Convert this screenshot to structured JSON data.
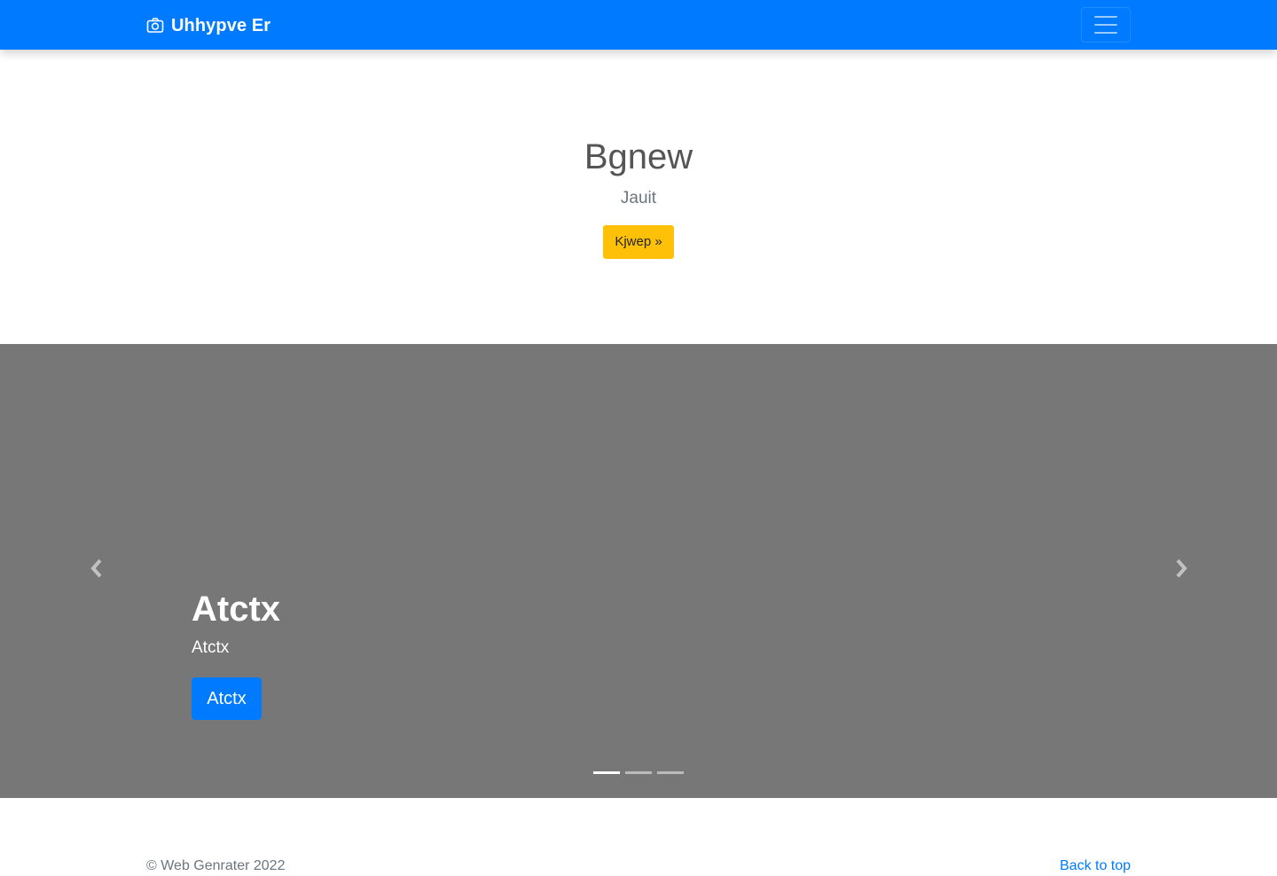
{
  "navbar": {
    "brand": "Uhhypve Er",
    "brand_icon": "camera-icon",
    "toggler_icon": "hamburger-menu-icon",
    "background_color": "#007bff"
  },
  "hero": {
    "title": "Bgnew",
    "subtitle": "Jauit",
    "button_label": "Kjwep »",
    "button_color": "#ffc107"
  },
  "carousel": {
    "background_color": "#777777",
    "prev_icon": "chevron-left-icon",
    "next_icon": "chevron-right-icon",
    "slide": {
      "title": "Atctx",
      "text": "Atctx",
      "button_label": "Atctx",
      "button_color": "#007bff"
    },
    "indicators": [
      {
        "active": true
      },
      {
        "active": false
      },
      {
        "active": false
      }
    ]
  },
  "footer": {
    "copyright": "© Web Genrater 2022",
    "back_to_top": "Back to top",
    "link_color": "#007bff"
  }
}
